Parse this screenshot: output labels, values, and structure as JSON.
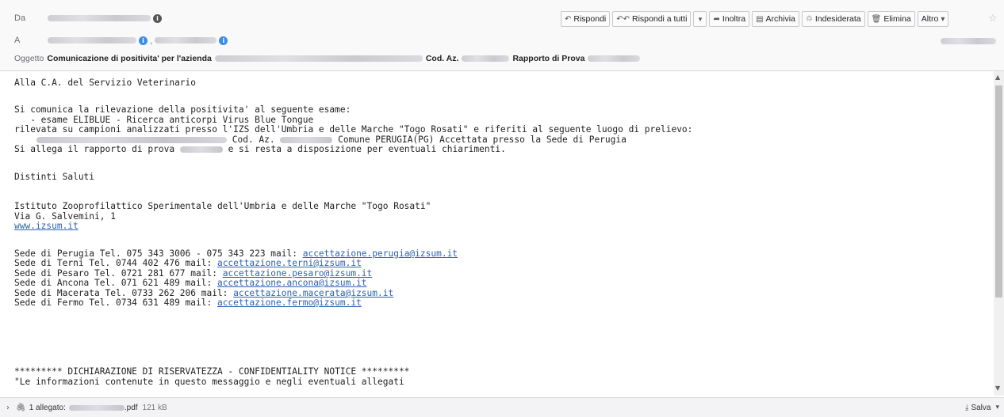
{
  "header": {
    "from_label": "Da",
    "to_label": "A",
    "subject_label": "Oggetto",
    "subject_part1": "Comunicazione di positivita' per l'azienda",
    "subject_codaz": "Cod. Az.",
    "subject_rapporto": "Rapporto di Prova"
  },
  "toolbar": {
    "reply": "Rispondi",
    "reply_all": "Rispondi a tutti",
    "forward": "Inoltra",
    "archive": "Archivia",
    "junk": "Indesiderata",
    "delete": "Elimina",
    "more": "Altro"
  },
  "body": {
    "l1": "Alla C.A. del Servizio Veterinario",
    "l2": "Si comunica la rilevazione della positivita' al seguente esame:",
    "l3": "   - esame ELIBLUE - Ricerca anticorpi Virus Blue Tongue",
    "l4": "rilevata su campioni analizzati presso l'IZS dell'Umbria e delle Marche \"Togo Rosati\" e riferiti al seguente luogo di prelievo:",
    "l5a": "Cod. Az.",
    "l5b": "Comune PERUGIA(PG) Accettata presso la Sede di Perugia",
    "l6a": "Si allega il rapporto di prova",
    "l6b": "e si resta a disposizione per eventuali chiarimenti.",
    "l7": "Distinti Saluti",
    "l8": "Istituto Zooprofilattico Sperimentale dell'Umbria e delle Marche \"Togo Rosati\"",
    "l9": "Via G. Salvemini, 1",
    "web": "www.izsum.it",
    "s1": "Sede di Perugia Tel. 075 343 3006 - 075 343 223 mail: ",
    "m1": "accettazione.perugia@izsum.it",
    "s2": "Sede di Terni Tel. 0744 402 476 mail: ",
    "m2": "accettazione.terni@izsum.it",
    "s3": "Sede di Pesaro Tel. 0721 281 677 mail: ",
    "m3": "accettazione.pesaro@izsum.it",
    "s4": "Sede di Ancona Tel. 071 621 489 mail: ",
    "m4": "accettazione.ancona@izsum.it",
    "s5": "Sede di Macerata Tel. 0733 262 206 mail: ",
    "m5": "accettazione.macerata@izsum.it",
    "s6": "Sede di Fermo Tel. 0734 631 489 mail: ",
    "m6": "accettazione.fermo@izsum.it",
    "c1": "********* DICHIARAZIONE DI RISERVATEZZA - CONFIDENTIALITY NOTICE *********",
    "c2": "\"Le informazioni contenute in questo messaggio e negli eventuali allegati"
  },
  "footer": {
    "attach_label": "1 allegato:",
    "attach_ext": ".pdf",
    "attach_size": "121 kB",
    "save": "Salva"
  },
  "icons": {
    "reply": "reply-icon",
    "reply_all": "reply-all-icon",
    "forward": "forward-icon",
    "archive": "archive-icon",
    "junk": "junk-icon",
    "delete": "trash-icon",
    "star": "star-icon",
    "paperclip": "paperclip-icon",
    "download": "download-icon"
  }
}
